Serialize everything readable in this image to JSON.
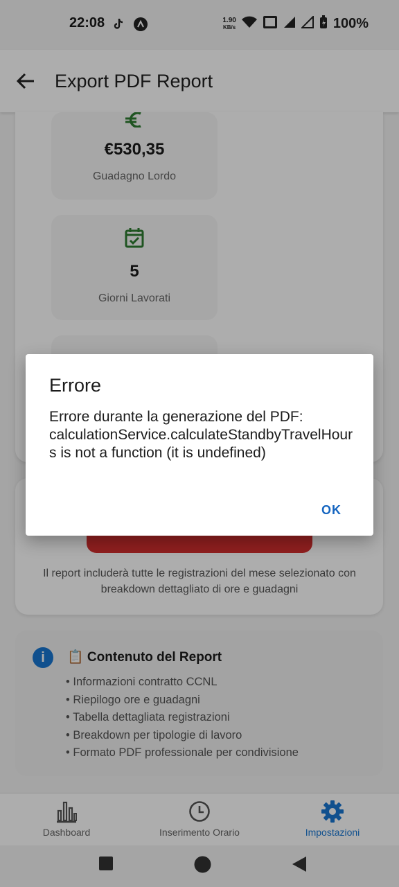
{
  "status_bar": {
    "time": "22:08",
    "speed_value": "1.90",
    "speed_unit": "KB/s",
    "battery": "100%"
  },
  "app_bar": {
    "title": "Export PDF Report"
  },
  "stats": [
    {
      "value": "€530,35",
      "label": "Guadagno Lordo",
      "icon": "euro-icon",
      "color": "#2e7d32"
    },
    {
      "value": "5",
      "label": "Giorni Lavorati",
      "icon": "calendar-check-icon",
      "color": "#2e7d32"
    }
  ],
  "export": {
    "note": "Il report includerà tutte le registrazioni del mese selezionato con breakdown dettagliato di ore e guadagni",
    "button_color": "#d32f2f"
  },
  "info": {
    "title": "📋 Contenuto del Report",
    "items": [
      "• Informazioni contratto CCNL",
      "• Riepilogo ore e guadagni",
      "• Tabella dettagliata registrazioni",
      "• Breakdown per tipologie di lavoro",
      "• Formato PDF professionale per condivisione"
    ]
  },
  "bottom_nav": [
    {
      "label": "Dashboard",
      "icon": "bar-chart-icon"
    },
    {
      "label": "Inserimento Orario",
      "icon": "clock-icon"
    },
    {
      "label": "Impostazioni",
      "icon": "gear-icon",
      "active": true
    }
  ],
  "dialog": {
    "title": "Errore",
    "message": "Errore durante la generazione del PDF: calculationService.calculateStandbyTravelHours is not a function (it is undefined)",
    "ok_label": "OK"
  },
  "colors": {
    "accent": "#1976d2",
    "error_button": "#d32f2f",
    "success_icon": "#2e7d32"
  }
}
